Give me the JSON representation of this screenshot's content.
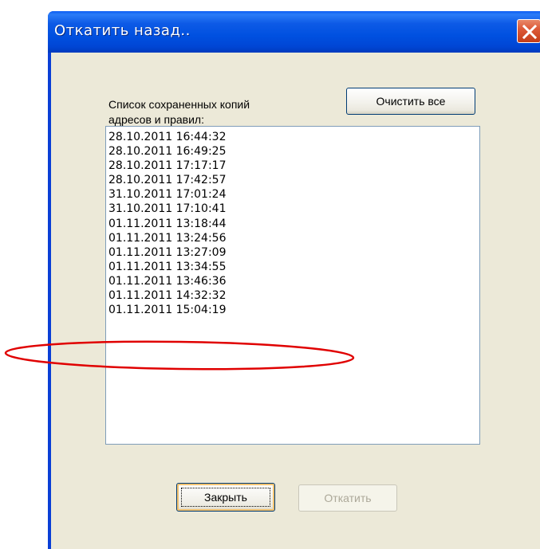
{
  "window": {
    "title": "Откатить назад..",
    "close_icon": "close-icon",
    "title_color": "#0054e3",
    "close_color": "#d84b27"
  },
  "dialog": {
    "list_label": "Список сохраненных копий адресов и правил:",
    "clear_all_label": "Очистить все",
    "backups": [
      "28.10.2011 16:44:32",
      "28.10.2011 16:49:25",
      "28.10.2011 17:17:17",
      "28.10.2011 17:42:57",
      "31.10.2011 17:01:24",
      "31.10.2011 17:10:41",
      "01.11.2011 13:18:44",
      "01.11.2011 13:24:56",
      "01.11.2011 13:27:09",
      "01.11.2011 13:34:55",
      "01.11.2011 13:46:36",
      "01.11.2011 14:32:32",
      "01.11.2011 15:04:19"
    ],
    "close_label": "Закрыть",
    "rollback_label": "Откатить",
    "rollback_enabled": false
  },
  "annotation": {
    "highlight_color": "#e00000",
    "highlighted_item": "01.11.2011 15:04:19"
  }
}
